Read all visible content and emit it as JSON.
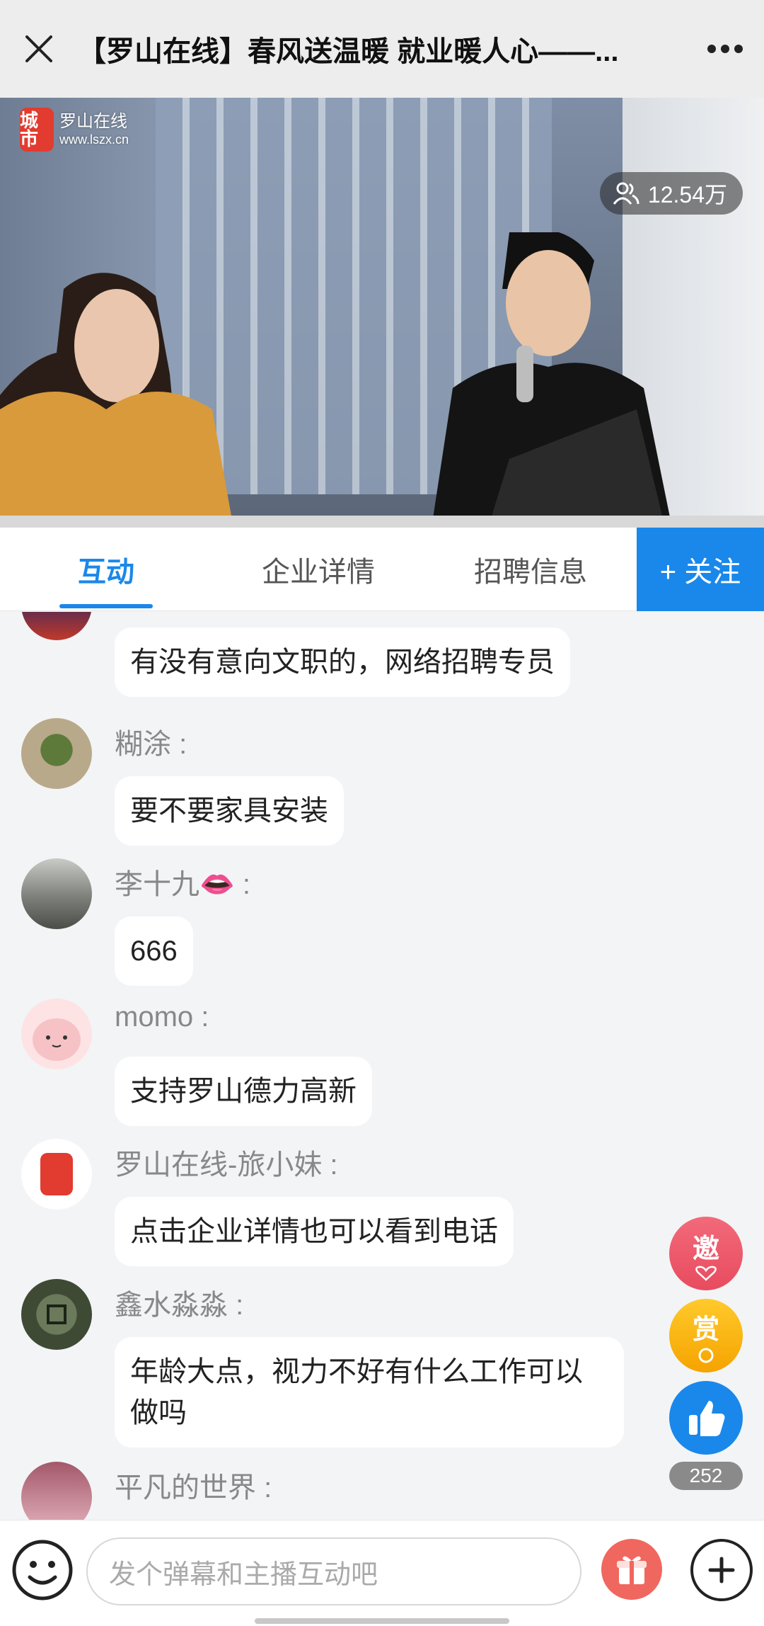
{
  "header": {
    "title": "【罗山在线】春风送温暖 就业暖人心——..."
  },
  "video": {
    "logo_badge": "城市",
    "logo_text_line1": "罗山在线",
    "logo_text_line2": "www.lszx.cn",
    "viewers": "12.54万"
  },
  "tabs": {
    "items": [
      {
        "label": "互动"
      },
      {
        "label": "企业详情"
      },
      {
        "label": "招聘信息"
      }
    ],
    "follow_label": "+ 关注"
  },
  "chat": {
    "messages": [
      {
        "name": "",
        "text": "有没有意向文职的，网络招聘专员"
      },
      {
        "name": "糊涂 :",
        "text": "要不要家具安装"
      },
      {
        "name": "李十九👄 :",
        "text": "666"
      },
      {
        "name": "momo :",
        "text": "支持罗山德力高新"
      },
      {
        "name": "罗山在线-旅小妹 :",
        "text": "点击企业详情也可以看到电话"
      },
      {
        "name": "鑫水淼淼 :",
        "text": "年龄大点，视力不好有什么工作可以做吗"
      },
      {
        "name": "平凡的世界 :",
        "text": ""
      }
    ]
  },
  "floating": {
    "invite_label": "邀",
    "reward_label": "赏",
    "like_count": "252"
  },
  "bottom": {
    "input_placeholder": "发个弹幕和主播互动吧"
  },
  "colors": {
    "accent": "#1a88ea",
    "invite": "#e84b5f",
    "reward": "#f5a300",
    "gift": "#f0675f"
  }
}
